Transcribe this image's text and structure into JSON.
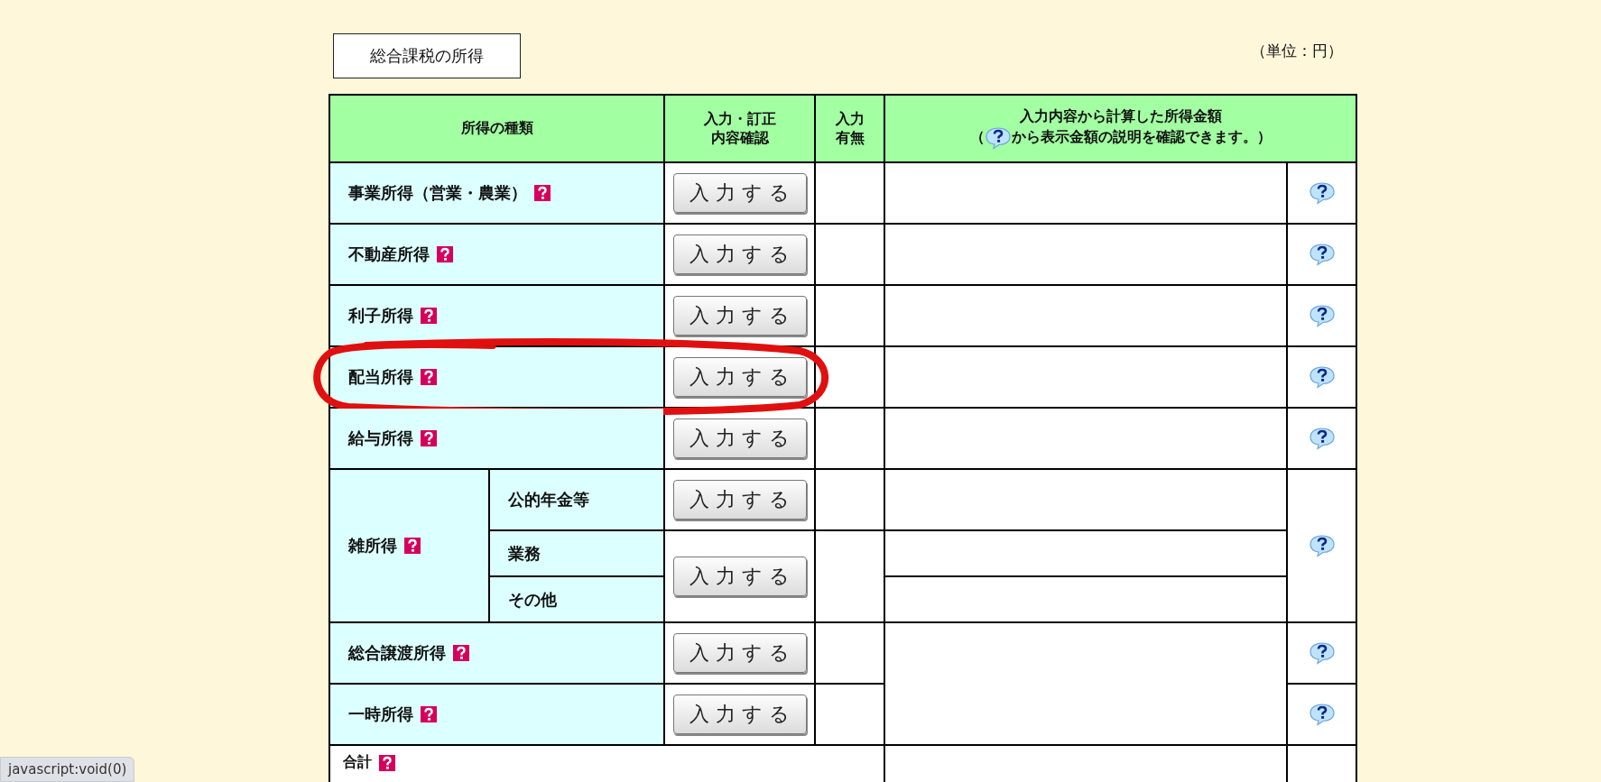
{
  "section_title": "総合課税の所得",
  "unit": "（単位：円）",
  "table": {
    "columns": [
      {
        "label": "所得の種類"
      },
      {
        "lines": [
          "入力・訂正",
          "内容確認"
        ]
      },
      {
        "lines": [
          "入力",
          "有無"
        ]
      },
      {
        "label": "入力内容から計算した所得金額",
        "note_before": "（",
        "note_after": "から表示金額の説明を確認できます。）"
      }
    ],
    "rows": [
      {
        "kind": "single",
        "label": "事業所得（営業・農業）",
        "button": "入力する",
        "circled": false,
        "merged_amount": false
      },
      {
        "kind": "single",
        "label": "不動産所得",
        "button": "入力する",
        "circled": false,
        "merged_amount": false
      },
      {
        "kind": "single",
        "label": "利子所得",
        "button": "入力する",
        "circled": false,
        "merged_amount": false
      },
      {
        "kind": "single",
        "label": "配当所得",
        "button": "入力する",
        "circled": true,
        "merged_amount": false
      },
      {
        "kind": "single",
        "label": "給与所得",
        "button": "入力する",
        "circled": false,
        "merged_amount": false
      },
      {
        "kind": "group",
        "label": "雑所得",
        "subrows": [
          {
            "label": "公的年金等",
            "button": "入力する"
          },
          {
            "label": "業務",
            "button": "入力する"
          },
          {
            "label": "その他"
          }
        ]
      },
      {
        "kind": "single",
        "label": "総合譲渡所得",
        "button": "入力する",
        "circled": false,
        "merged_amount": true
      },
      {
        "kind": "single",
        "label": "一時所得",
        "button": "入力する",
        "circled": false,
        "merged_amount": false
      },
      {
        "kind": "total",
        "label": "合計"
      }
    ]
  },
  "status_bar": "javascript:void(0)"
}
